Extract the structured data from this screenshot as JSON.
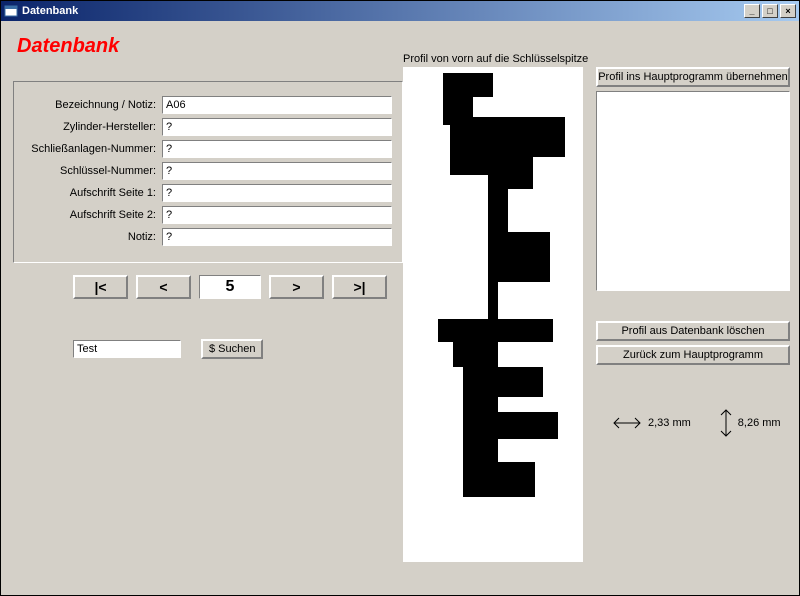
{
  "window": {
    "title": "Datenbank"
  },
  "heading": "Datenbank",
  "form": {
    "labels": {
      "bez": "Bezeichnung / Notiz:",
      "hersteller": "Zylinder-Hersteller:",
      "anlagen": "Schließanlagen-Nummer:",
      "schluessel": "Schlüssel-Nummer:",
      "seite1": "Aufschrift Seite 1:",
      "seite2": "Aufschrift Seite 2:",
      "notiz": "Notiz:"
    },
    "values": {
      "bez": "A06",
      "hersteller": "?",
      "anlagen": "?",
      "schluessel": "?",
      "seite1": "?",
      "seite2": "?",
      "notiz": "?"
    }
  },
  "nav": {
    "first": "|<",
    "prev": "<",
    "current": "5",
    "next": ">",
    "last": ">|"
  },
  "search": {
    "value": "Test",
    "button_label": "$ Suchen"
  },
  "profile": {
    "caption": "Profil von vorn auf die Schlüsselspitze"
  },
  "right": {
    "apply_label": "Profil ins Hauptprogramm übernehmen",
    "delete_label": "Profil aus Datenbank löschen",
    "back_label": "Zurück zum Hauptprogramm"
  },
  "dims": {
    "width": "2,33 mm",
    "height": "8,26 mm"
  },
  "titlebar_btns": {
    "min": "_",
    "max": "□",
    "close": "×"
  }
}
